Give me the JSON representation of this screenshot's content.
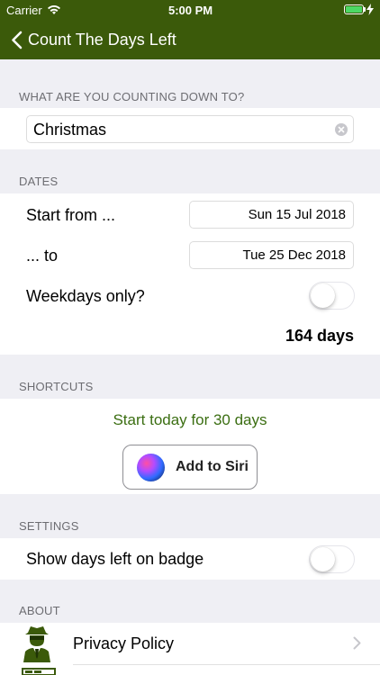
{
  "status_bar": {
    "carrier": "Carrier",
    "time": "5:00 PM"
  },
  "nav": {
    "back_label": "Count The Days Left"
  },
  "countdown": {
    "header": "WHAT ARE YOU COUNTING DOWN TO?",
    "name_value": "Christmas"
  },
  "dates": {
    "header": "DATES",
    "start_label": "Start from ...",
    "start_value": "Sun 15 Jul 2018",
    "end_label": "... to",
    "end_value": "Tue 25 Dec 2018",
    "weekdays_label": "Weekdays only?",
    "weekdays_on": false,
    "result": "164 days"
  },
  "shortcuts": {
    "header": "SHORTCUTS",
    "suggestion": "Start today for 30 days",
    "siri_label": "Add to Siri"
  },
  "settings": {
    "header": "SETTINGS",
    "badge_label": "Show days left on badge",
    "badge_on": false
  },
  "about": {
    "header": "ABOUT",
    "privacy_label": "Privacy Policy"
  },
  "colors": {
    "nav_bar": "#3b5a0a",
    "accent_text": "#3b6e12"
  }
}
